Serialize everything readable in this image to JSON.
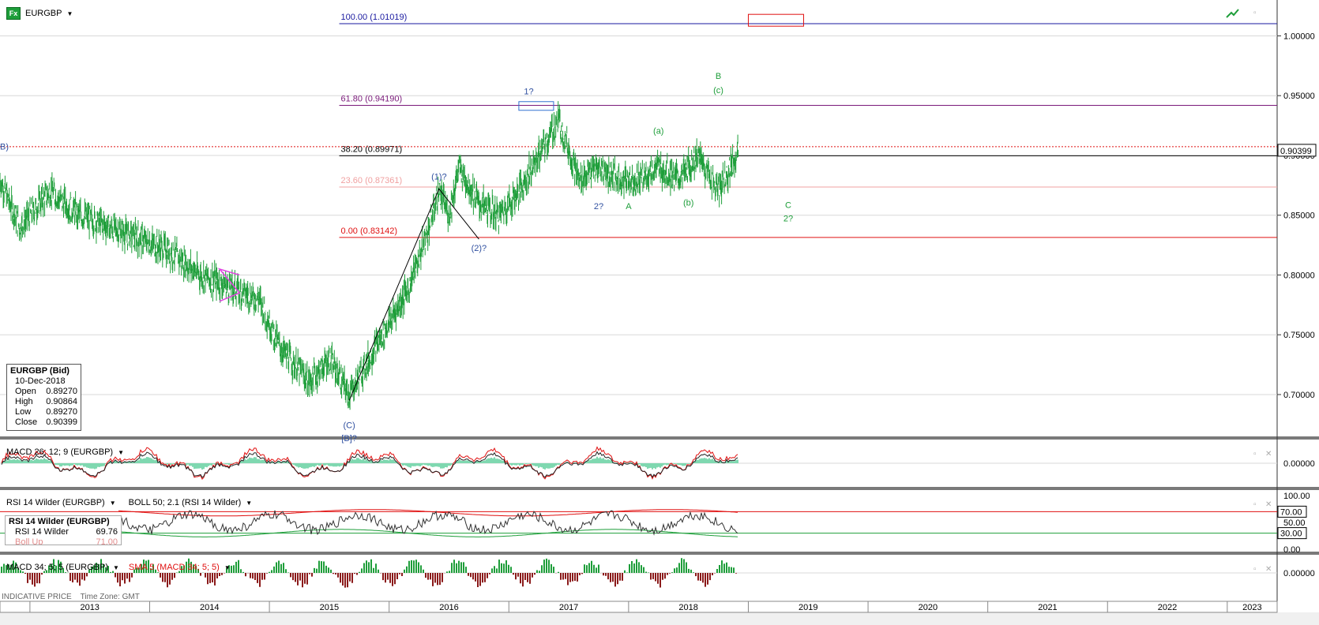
{
  "header": {
    "symbol_icon": "Fx",
    "symbol": "EURGBP"
  },
  "colors": {
    "candle": "#1e9e3a",
    "fib100": "#1a1aa0",
    "fib618": "#7a1a7a",
    "fib382": "#000000",
    "fib236": "#f0a0a0",
    "fib0": "#e01010",
    "wave_blue": "#3050a0",
    "wave_green": "#1e9e3a",
    "grid": "#d8d8d8",
    "panel_separator": "#8a8a8a"
  },
  "chart_data": [
    {
      "type": "line",
      "title": "EURGBP",
      "series": [
        {
          "name": "EURGBP",
          "x": [
            "2012-10",
            "2012-12",
            "2013-03",
            "2013-06",
            "2013-09",
            "2013-12",
            "2014-03",
            "2014-06",
            "2014-09",
            "2014-12",
            "2015-02",
            "2015-05",
            "2015-07",
            "2015-09",
            "2015-11",
            "2016-01",
            "2016-03",
            "2016-05",
            "2016-06",
            "2016-07",
            "2016-08",
            "2016-10",
            "2016-12",
            "2017-02",
            "2017-04",
            "2017-06",
            "2017-08",
            "2017-10",
            "2017-12",
            "2018-02",
            "2018-04",
            "2018-06",
            "2018-08",
            "2018-10",
            "2018-12"
          ],
          "values": [
            0.88,
            0.84,
            0.87,
            0.85,
            0.84,
            0.83,
            0.82,
            0.8,
            0.79,
            0.78,
            0.74,
            0.71,
            0.73,
            0.7,
            0.73,
            0.76,
            0.79,
            0.84,
            0.87,
            0.85,
            0.89,
            0.86,
            0.85,
            0.87,
            0.9,
            0.93,
            0.88,
            0.89,
            0.88,
            0.88,
            0.89,
            0.88,
            0.9,
            0.87,
            0.90399
          ]
        }
      ],
      "ylim": [
        0.665,
        1.03
      ],
      "xlim": [
        "2012-10",
        "2023-06"
      ],
      "y_ticks": [
        "0.70000",
        "0.75000",
        "0.80000",
        "0.85000",
        "0.90000",
        "0.95000",
        "1.00000"
      ],
      "x_ticks": [
        "2013",
        "2014",
        "2015",
        "2016",
        "2017",
        "2018",
        "2019",
        "2020",
        "2021",
        "2022",
        "2023"
      ],
      "last_price_label": "0.90399",
      "fibonacci_levels": [
        {
          "label": "100.00 (1.01019)",
          "value": 1.01019
        },
        {
          "label": "61.80 (0.94190)",
          "value": 0.9419
        },
        {
          "label": "38.20 (0.89971)",
          "value": 0.89971
        },
        {
          "label": "23.60 (0.87361)",
          "value": 0.87361
        },
        {
          "label": "0.00 (0.83142)",
          "value": 0.83142
        }
      ],
      "annotations": [
        "B)",
        "(C)",
        "[B]?",
        "(1)?",
        "(2)?",
        "1?",
        "2?",
        "A",
        "(a)",
        "(b)",
        "B",
        "(c)",
        "C",
        "2?"
      ],
      "grid": true
    },
    {
      "type": "bar",
      "title": "MACD 26; 12; 9 (EURGBP)",
      "y_ticks": [
        "0.00000"
      ],
      "zero_label": "0.00000"
    },
    {
      "type": "line",
      "title": "RSI 14 Wilder (EURGBP)",
      "overlay_title": "BOLL 50; 2.1 (RSI 14 Wilder)",
      "y_ticks": [
        "100.00",
        "50.00",
        "0.00"
      ],
      "levels": [
        {
          "label": "70.00",
          "value": 70
        },
        {
          "label": "30.00",
          "value": 30
        }
      ],
      "ylim": [
        0,
        100
      ]
    },
    {
      "type": "bar",
      "title": "MACD 34; 5; 5 (EURGBP)",
      "overlay_title": "SMA 5 (MACD 34; 5; 5)",
      "y_ticks": [
        "0.00000"
      ]
    }
  ],
  "infobox": {
    "title": "EURGBP (Bid)",
    "date": "10-Dec-2018",
    "rows": [
      {
        "label": "Open",
        "value": "0.89270"
      },
      {
        "label": "High",
        "value": "0.90864"
      },
      {
        "label": "Low",
        "value": "0.89270"
      },
      {
        "label": "Close",
        "value": "0.90399"
      }
    ]
  },
  "rsibox": {
    "title": "RSI 14 Wilder (EURGBP)",
    "row_label": "RSI 14 Wilder",
    "row_value": "69.76",
    "row2_label": "Boll Up",
    "row2_value": "71.00"
  },
  "footer": {
    "price_type": "INDICATIVE PRICE",
    "tz": "Time Zone: GMT"
  }
}
